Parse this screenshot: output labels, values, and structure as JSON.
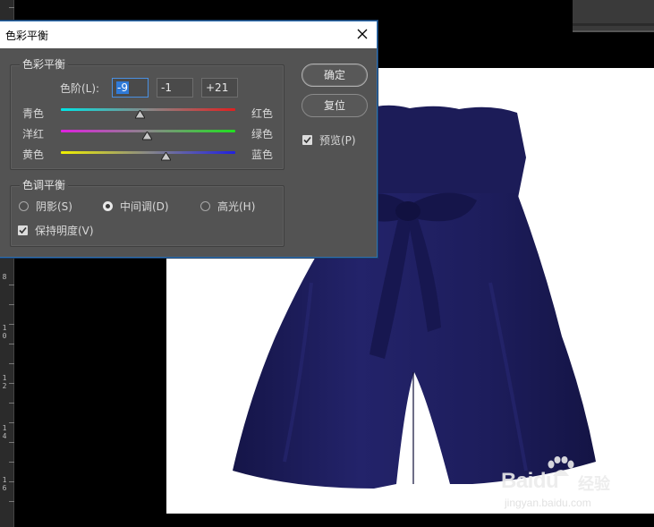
{
  "ruler": {
    "numbers": [
      "8",
      "1\n0",
      "1\n2",
      "1\n4",
      "1\n6"
    ]
  },
  "dialog": {
    "title": "色彩平衡",
    "close_icon": "close-icon",
    "color_balance_group": {
      "title": "色彩平衡",
      "levels_label": "色阶(L):",
      "levels": [
        "-9",
        "-1",
        "+21"
      ],
      "levels_fraction": [
        0.455,
        0.495,
        0.605
      ],
      "sliders": [
        {
          "left": "青色",
          "right": "红色",
          "gradient": [
            "#00e5e5",
            "#e02020"
          ]
        },
        {
          "left": "洋红",
          "right": "绿色",
          "gradient": [
            "#e020e0",
            "#20e020"
          ]
        },
        {
          "left": "黄色",
          "right": "蓝色",
          "gradient": [
            "#f0f000",
            "#2020e0"
          ]
        }
      ]
    },
    "tone_balance_group": {
      "title": "色调平衡",
      "options": [
        "阴影(S)",
        "中间调(D)",
        "高光(H)"
      ],
      "selected": "中间调(D)",
      "preserve_luminosity_label": "保持明度(V)",
      "preserve_luminosity_checked": true
    },
    "buttons": {
      "ok_label": "确定",
      "reset_label": "复位"
    },
    "preview_label": "预览(P)",
    "preview_checked": true
  },
  "watermark": {
    "logo": "Baidu",
    "cn": "经验",
    "url": "jingyan.baidu.com"
  },
  "colors": {
    "shorts": "#1f1f5c",
    "dialog_bg": "#535353",
    "accent": "#2f7ad8"
  }
}
